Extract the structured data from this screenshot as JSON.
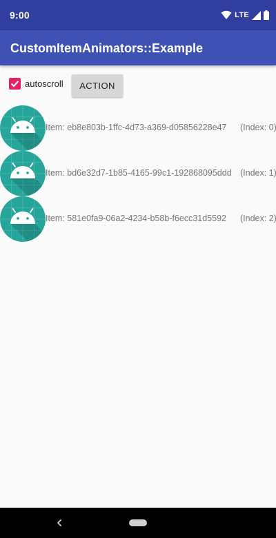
{
  "status_bar": {
    "time": "9:00",
    "network": "LTE",
    "icons": [
      "wifi-icon",
      "lte-signal-icon",
      "battery-icon"
    ]
  },
  "app_bar": {
    "title": "CustomItemAnimators::Example"
  },
  "controls": {
    "autoscroll_label": "autoscroll",
    "autoscroll_checked": true,
    "action_label": "ACTION"
  },
  "items": [
    {
      "text": "Item: eb8e803b-1ffc-4d73-a369-d05856228e47",
      "index": "(Index: 0)"
    },
    {
      "text": "Item: bd6e32d7-1b85-4165-99c1-192868095ddd",
      "index": "(Index: 1)"
    },
    {
      "text": "Item: 581e0fa9-06a2-4234-b58b-f6ecc31d5592",
      "index": "(Index: 2)"
    }
  ],
  "nav_bar": {
    "icons": [
      "back-icon",
      "home-pill-icon"
    ]
  },
  "colors": {
    "status_bar": "#303f9f",
    "app_bar": "#3f51b5",
    "accent": "#e91e63",
    "avatar_bg": "#26a69a",
    "background": "#fafafa"
  }
}
